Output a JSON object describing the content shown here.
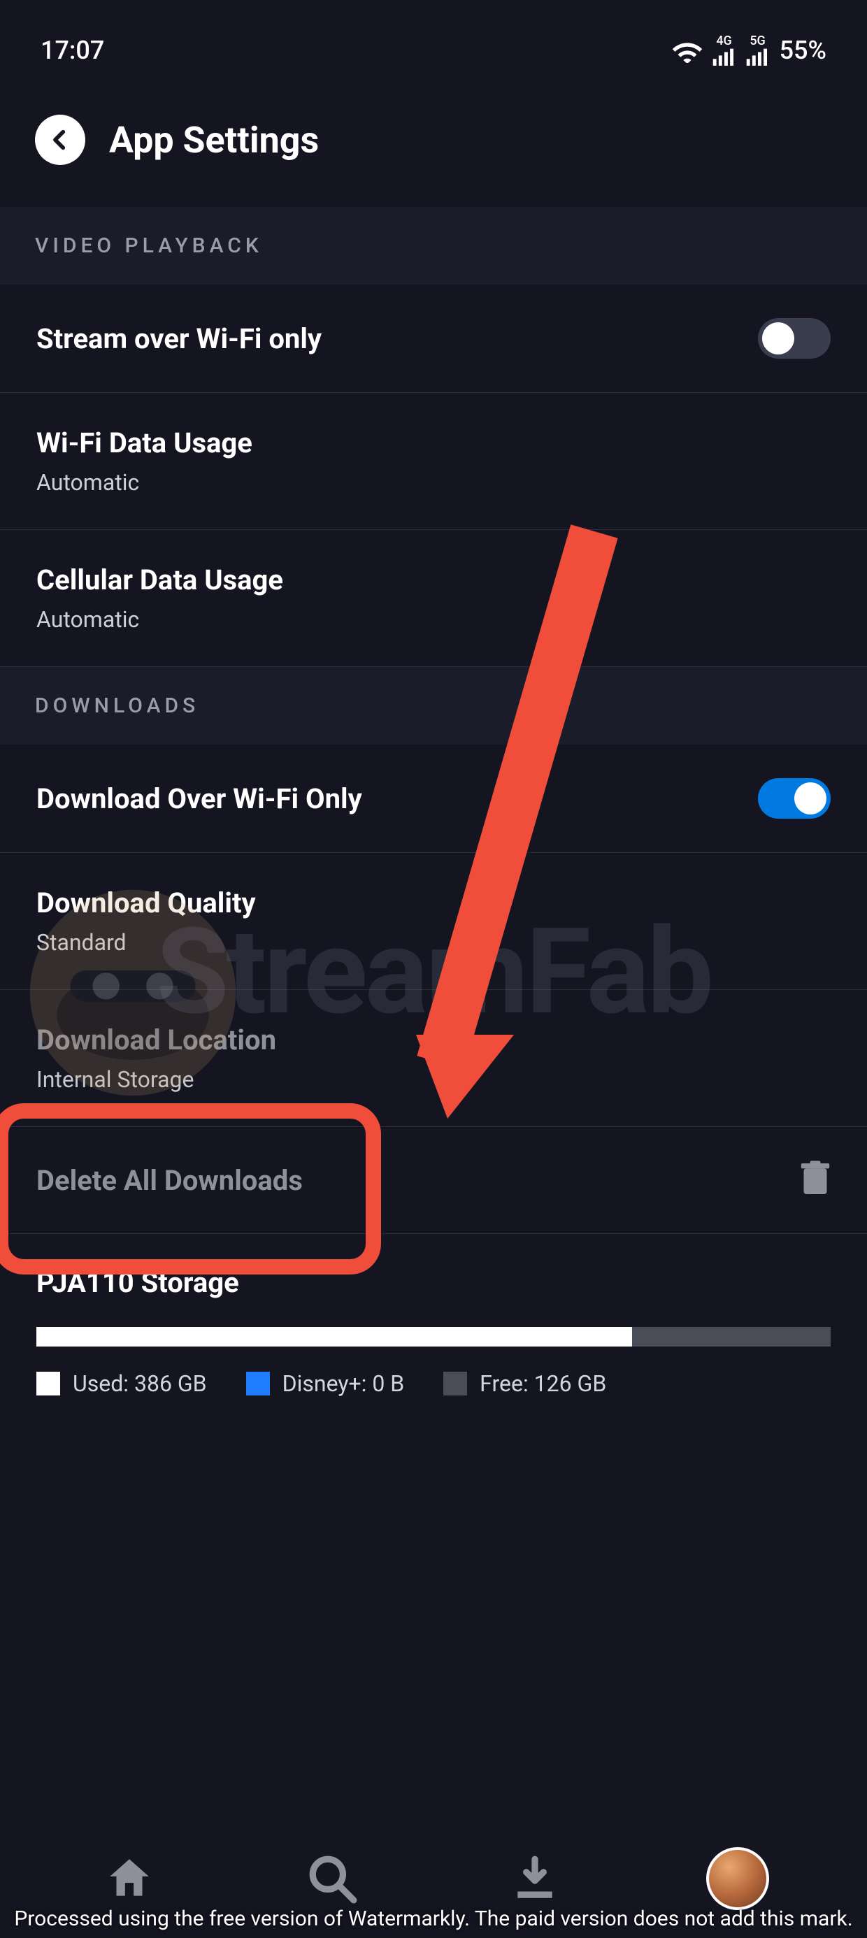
{
  "status": {
    "time": "17:07",
    "battery": "55%",
    "net4g": "4G",
    "net5g": "5G"
  },
  "header": {
    "title": "App Settings"
  },
  "sections": {
    "video_playback": "VIDEO PLAYBACK",
    "downloads": "DOWNLOADS"
  },
  "rows": {
    "stream_wifi": {
      "title": "Stream over Wi-Fi only"
    },
    "wifi_usage": {
      "title": "Wi-Fi Data Usage",
      "sub": "Automatic"
    },
    "cell_usage": {
      "title": "Cellular Data Usage",
      "sub": "Automatic"
    },
    "dl_wifi": {
      "title": "Download Over Wi-Fi Only"
    },
    "dl_quality": {
      "title": "Download Quality",
      "sub": "Standard"
    },
    "dl_location": {
      "title": "Download Location",
      "sub": "Internal Storage"
    },
    "delete_all": {
      "title": "Delete All Downloads"
    }
  },
  "storage": {
    "title": "PJA110 Storage",
    "used_label": "Used: 386 GB",
    "app_label": "Disney+: 0 B",
    "free_label": "Free: 126 GB",
    "used_pct": 75,
    "app_pct": 0
  },
  "watermark_text": "StreamFab",
  "footer_note": "Processed using the free version of Watermarkly. The paid version does not add this mark."
}
